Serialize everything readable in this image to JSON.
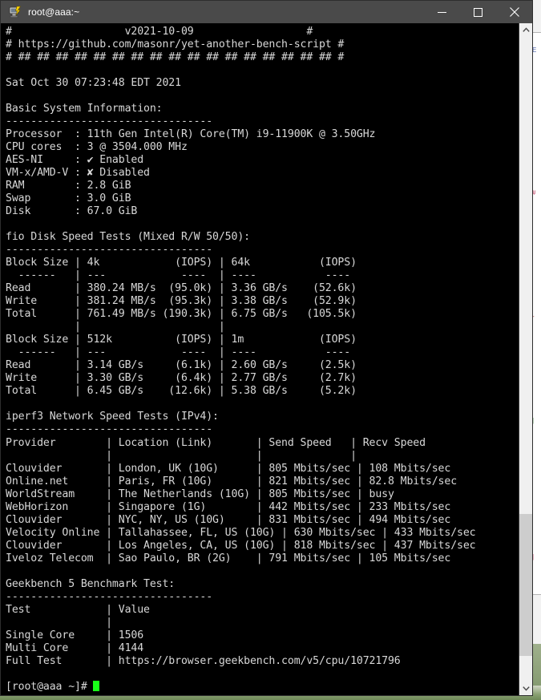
{
  "window": {
    "title": "root@aaa:~",
    "icon": "putty-icon",
    "minimize_label": "—",
    "maximize_label": "☐",
    "close_label": "✕"
  },
  "scrollbar": {
    "up_arrow": "⌃",
    "down_arrow": "⌄"
  },
  "terminal": {
    "lines": [
      "#                  v2021-10-09                  #",
      "# https://github.com/masonr/yet-another-bench-script #",
      "# ## ## ## ## ## ## ## ## ## ## ## ## ## ## ## ## ## #",
      "",
      "Sat Oct 30 07:23:48 EDT 2021",
      "",
      "Basic System Information:",
      "---------------------------------",
      "Processor  : 11th Gen Intel(R) Core(TM) i9-11900K @ 3.50GHz",
      "CPU cores  : 3 @ 3504.000 MHz",
      "AES-NI     : ✔ Enabled",
      "VM-x/AMD-V : ✘ Disabled",
      "RAM        : 2.8 GiB",
      "Swap       : 3.0 GiB",
      "Disk       : 67.0 GiB",
      "",
      "fio Disk Speed Tests (Mixed R/W 50/50):",
      "---------------------------------",
      "Block Size | 4k            (IOPS) | 64k           (IOPS)",
      "  ------   | ---            ----  | ----           ---- ",
      "Read       | 380.24 MB/s  (95.0k) | 3.36 GB/s    (52.6k)",
      "Write      | 381.24 MB/s  (95.3k) | 3.38 GB/s    (52.9k)",
      "Total      | 761.49 MB/s (190.3k) | 6.75 GB/s   (105.5k)",
      "           |                      |                     ",
      "Block Size | 512k          (IOPS) | 1m            (IOPS)",
      "  ------   | ---            ----  | ----           ---- ",
      "Read       | 3.14 GB/s     (6.1k) | 2.60 GB/s     (2.5k)",
      "Write      | 3.30 GB/s     (6.4k) | 2.77 GB/s     (2.7k)",
      "Total      | 6.45 GB/s    (12.6k) | 5.38 GB/s     (5.2k)",
      "",
      "iperf3 Network Speed Tests (IPv4):",
      "---------------------------------",
      "Provider        | Location (Link)       | Send Speed   | Recv Speed  ",
      "                |                       |              |             ",
      "Clouvider       | London, UK (10G)      | 805 Mbits/sec | 108 Mbits/sec",
      "Online.net      | Paris, FR (10G)       | 821 Mbits/sec | 82.8 Mbits/sec",
      "WorldStream     | The Netherlands (10G) | 805 Mbits/sec | busy",
      "WebHorizon      | Singapore (1G)        | 442 Mbits/sec | 233 Mbits/sec",
      "Clouvider       | NYC, NY, US (10G)     | 831 Mbits/sec | 494 Mbits/sec",
      "Velocity Online | Tallahassee, FL, US (10G) | 630 Mbits/sec | 433 Mbits/sec",
      "Clouvider       | Los Angeles, CA, US (10G) | 818 Mbits/sec | 437 Mbits/sec",
      "Iveloz Telecom  | Sao Paulo, BR (2G)    | 791 Mbits/sec | 105 Mbits/sec",
      "",
      "Geekbench 5 Benchmark Test:",
      "---------------------------------",
      "Test            | Value",
      "                |",
      "Single Core     | 1506",
      "Multi Core      | 4144",
      "Full Test       | https://browser.geekbench.com/v5/cpu/10721796",
      "",
      "[root@aaa ~]# "
    ],
    "prompt": "[root@aaa ~]# ",
    "cursor": "block-cursor",
    "colors": {
      "background": "#000000",
      "foreground": "#d8d8d8",
      "cursor": "#18ff18"
    }
  },
  "report": {
    "version": "v2021-10-09",
    "repo_url": "https://github.com/masonr/yet-another-bench-script",
    "timestamp": "Sat Oct 30 07:23:48 EDT 2021",
    "system_info": {
      "heading": "Basic System Information:",
      "rows": [
        {
          "label": "Processor",
          "value": "11th Gen Intel(R) Core(TM) i9-11900K @ 3.50GHz"
        },
        {
          "label": "CPU cores",
          "value": "3 @ 3504.000 MHz"
        },
        {
          "label": "AES-NI",
          "value": "Enabled",
          "glyph": "check"
        },
        {
          "label": "VM-x/AMD-V",
          "value": "Disabled",
          "glyph": "cross"
        },
        {
          "label": "RAM",
          "value": "2.8 GiB"
        },
        {
          "label": "Swap",
          "value": "3.0 GiB"
        },
        {
          "label": "Disk",
          "value": "67.0 GiB"
        }
      ]
    },
    "fio": {
      "heading": "fio Disk Speed Tests (Mixed R/W 50/50):",
      "blocks": [
        {
          "col1_label": "4k",
          "col2_label": "64k",
          "iops_label": "(IOPS)",
          "rows": [
            {
              "name": "Read",
              "c1": "380.24 MB/s",
              "c1_iops": "(95.0k)",
              "c2": "3.36 GB/s",
              "c2_iops": "(52.6k)"
            },
            {
              "name": "Write",
              "c1": "381.24 MB/s",
              "c1_iops": "(95.3k)",
              "c2": "3.38 GB/s",
              "c2_iops": "(52.9k)"
            },
            {
              "name": "Total",
              "c1": "761.49 MB/s",
              "c1_iops": "(190.3k)",
              "c2": "6.75 GB/s",
              "c2_iops": "(105.5k)"
            }
          ]
        },
        {
          "col1_label": "512k",
          "col2_label": "1m",
          "iops_label": "(IOPS)",
          "rows": [
            {
              "name": "Read",
              "c1": "3.14 GB/s",
              "c1_iops": "(6.1k)",
              "c2": "2.60 GB/s",
              "c2_iops": "(2.5k)"
            },
            {
              "name": "Write",
              "c1": "3.30 GB/s",
              "c1_iops": "(6.4k)",
              "c2": "2.77 GB/s",
              "c2_iops": "(2.7k)"
            },
            {
              "name": "Total",
              "c1": "6.45 GB/s",
              "c1_iops": "(12.6k)",
              "c2": "5.38 GB/s",
              "c2_iops": "(5.2k)"
            }
          ]
        }
      ]
    },
    "iperf3": {
      "heading": "iperf3 Network Speed Tests (IPv4):",
      "columns": [
        "Provider",
        "Location (Link)",
        "Send Speed",
        "Recv Speed"
      ],
      "rows": [
        {
          "provider": "Clouvider",
          "location": "London, UK (10G)",
          "send": "805 Mbits/sec",
          "recv": "108 Mbits/sec"
        },
        {
          "provider": "Online.net",
          "location": "Paris, FR (10G)",
          "send": "821 Mbits/sec",
          "recv": "82.8 Mbits/sec"
        },
        {
          "provider": "WorldStream",
          "location": "The Netherlands (10G)",
          "send": "805 Mbits/sec",
          "recv": "busy"
        },
        {
          "provider": "WebHorizon",
          "location": "Singapore (1G)",
          "send": "442 Mbits/sec",
          "recv": "233 Mbits/sec"
        },
        {
          "provider": "Clouvider",
          "location": "NYC, NY, US (10G)",
          "send": "831 Mbits/sec",
          "recv": "494 Mbits/sec"
        },
        {
          "provider": "Velocity Online",
          "location": "Tallahassee, FL, US (10G)",
          "send": "630 Mbits/sec",
          "recv": "433 Mbits/sec"
        },
        {
          "provider": "Clouvider",
          "location": "Los Angeles, CA, US (10G)",
          "send": "818 Mbits/sec",
          "recv": "437 Mbits/sec"
        },
        {
          "provider": "Iveloz Telecom",
          "location": "Sao Paulo, BR (2G)",
          "send": "791 Mbits/sec",
          "recv": "105 Mbits/sec"
        }
      ]
    },
    "geekbench": {
      "heading": "Geekbench 5 Benchmark Test:",
      "columns": [
        "Test",
        "Value"
      ],
      "rows": [
        {
          "test": "Single Core",
          "value": "1506"
        },
        {
          "test": "Multi Core",
          "value": "4144"
        },
        {
          "test": "Full Test",
          "value": "https://browser.geekbench.com/v5/cpu/10721796"
        }
      ]
    }
  }
}
